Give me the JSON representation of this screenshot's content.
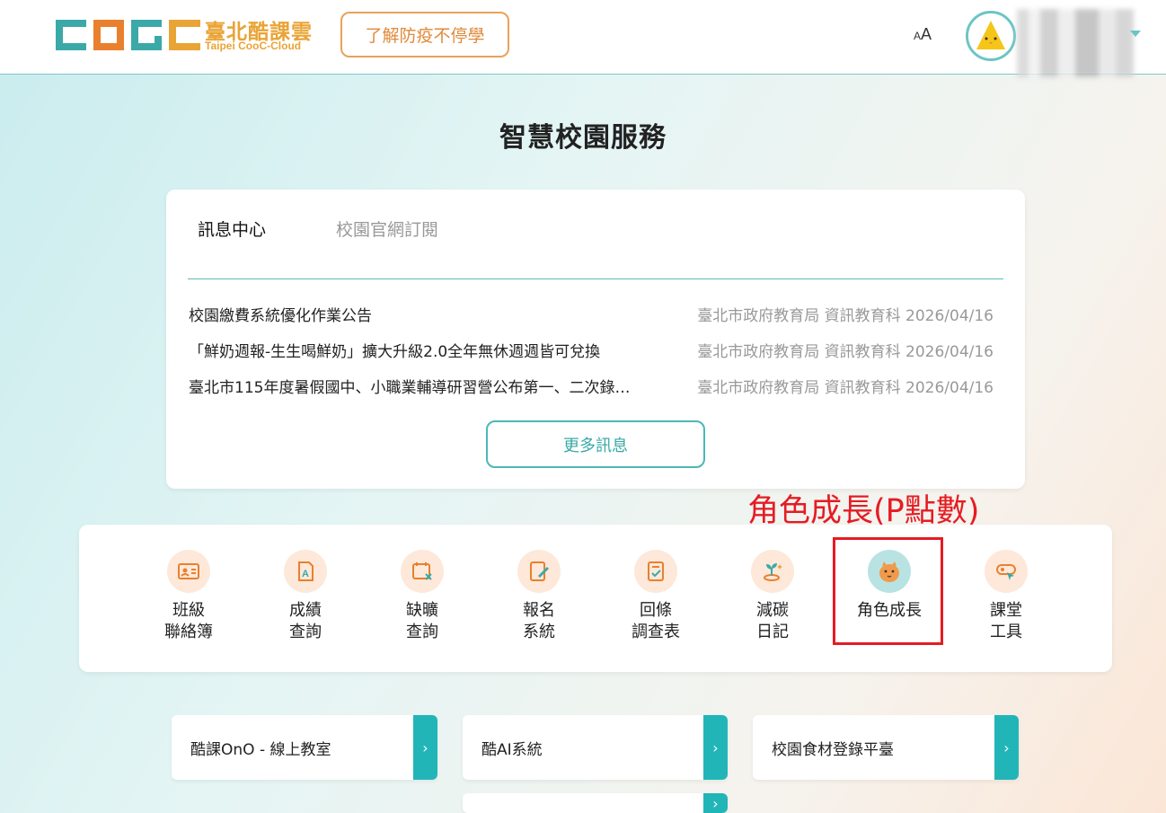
{
  "header": {
    "logo_title": "臺北酷課雲",
    "logo_subtitle": "Taipei CooC-Cloud",
    "covid_button": "了解防疫不停學",
    "font_size_small": "A",
    "font_size_large": "A"
  },
  "page_title": "智慧校園服務",
  "news": {
    "tabs": [
      {
        "label": "訊息中心",
        "active": true
      },
      {
        "label": "校園官網訂閱",
        "active": false
      }
    ],
    "items": [
      {
        "title": "校園繳費系統優化作業公告",
        "meta": "臺北市政府教育局 資訊教育科 2026/04/16"
      },
      {
        "title": "「鮮奶週報-生生喝鮮奶」擴大升級2.0全年無休週週皆可兌換",
        "meta": "臺北市政府教育局 資訊教育科 2026/04/16"
      },
      {
        "title": "臺北市115年度暑假國中、小職業輔導研習營公布第一、二次錄…",
        "meta": "臺北市政府教育局 資訊教育科 2026/04/16"
      }
    ],
    "more_button": "更多訊息"
  },
  "annotation": "角色成長(P點數)",
  "services": [
    {
      "line1": "班級",
      "line2": "聯絡簿",
      "icon": "contact-book-icon"
    },
    {
      "line1": "成績",
      "line2": "查詢",
      "icon": "grade-report-icon"
    },
    {
      "line1": "缺曠",
      "line2": "查詢",
      "icon": "absence-calendar-icon"
    },
    {
      "line1": "報名",
      "line2": "系統",
      "icon": "registration-icon"
    },
    {
      "line1": "回條",
      "line2": "調查表",
      "icon": "reply-slip-icon"
    },
    {
      "line1": "減碳",
      "line2": "日記",
      "icon": "sprout-coin-icon"
    },
    {
      "line1": "角色成長",
      "line2": "",
      "icon": "character-growth-icon"
    },
    {
      "line1": "課堂",
      "line2": "工具",
      "icon": "classroom-tools-icon"
    }
  ],
  "links": [
    {
      "label": "酷課OnO - 線上教室",
      "arrow": "›"
    },
    {
      "label": "酷AI系統",
      "arrow": "›"
    },
    {
      "label": "校園食材登錄平臺",
      "arrow": "›"
    },
    {
      "label": "",
      "arrow": "›"
    }
  ],
  "colors": {
    "brand_teal": "#22b5b8",
    "brand_orange": "#e9a436",
    "annotation_red": "#e51c23",
    "icon_bg": "#fde8d9"
  }
}
